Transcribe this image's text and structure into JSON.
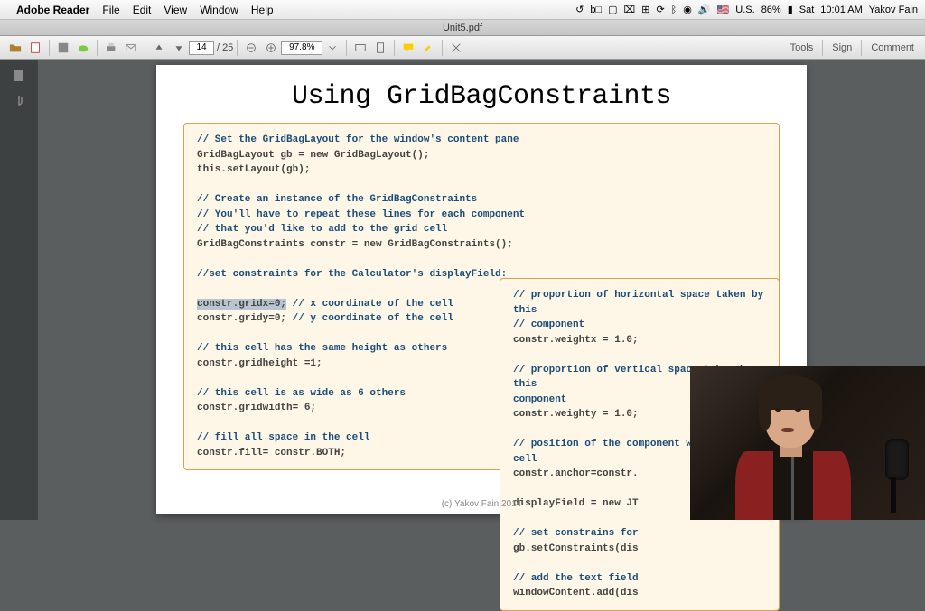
{
  "menubar": {
    "app": "Adobe Reader",
    "items": [
      "File",
      "Edit",
      "View",
      "Window",
      "Help"
    ],
    "status": {
      "flag": "🇺🇸",
      "locale": "U.S.",
      "battery": "86%",
      "day": "Sat",
      "time": "10:01 AM",
      "user": "Yakov Fain"
    }
  },
  "tab": {
    "title": "Unit5.pdf"
  },
  "toolbar": {
    "page_current": "14",
    "page_sep": "/",
    "page_total": "25",
    "zoom": "97.8%",
    "side": {
      "tools": "Tools",
      "sign": "Sign",
      "comment": "Comment"
    }
  },
  "doc": {
    "heading": "Using GridBagConstraints",
    "left": {
      "l1": "// Set the GridBagLayout for the window's content pane",
      "l2": " GridBagLayout gb = new GridBagLayout();",
      "l3": " this.setLayout(gb);",
      "l4": "// Create an instance of the GridBagConstraints",
      "l5": "// You'll have to repeat these lines for each component",
      "l6": "// that you'd like to add to the grid cell",
      "l7": " GridBagConstraints constr = new GridBagConstraints();",
      "l8": "//set constraints for the Calculator's displayField:",
      "l9a": "constr.gridx=0;",
      "l9b": " // x coordinate of the cell",
      "l10a": "constr.gridy=0;",
      "l10b": " // y coordinate of the cell",
      "l11": "// this cell has the same height as others",
      "l12": "constr.gridheight =1;",
      "l13": "// this cell is as wide as 6 others",
      "l14": "constr.gridwidth= 6;",
      "l15": "// fill all space in the cell",
      "l16": "constr.fill= constr.BOTH;"
    },
    "right": {
      "r1": "// proportion of horizontal space  taken by  this",
      "r2": "// component",
      "r3": " constr.weightx = 1.0;",
      "r4": "// proportion of  vertical space taken by  this",
      "r5": "   component",
      "r6": " constr.weighty = 1.0;",
      "r7": "// position of the component within the cell",
      "r8": " constr.anchor=constr.",
      "r9": " displayField = new JT",
      "r10": "// set constrains for",
      "r11": " gb.setConstraints(dis",
      "r12": "// add the text field",
      "r13": " windowContent.add(dis"
    },
    "credit": "(c) Yakov Fain  2014"
  }
}
